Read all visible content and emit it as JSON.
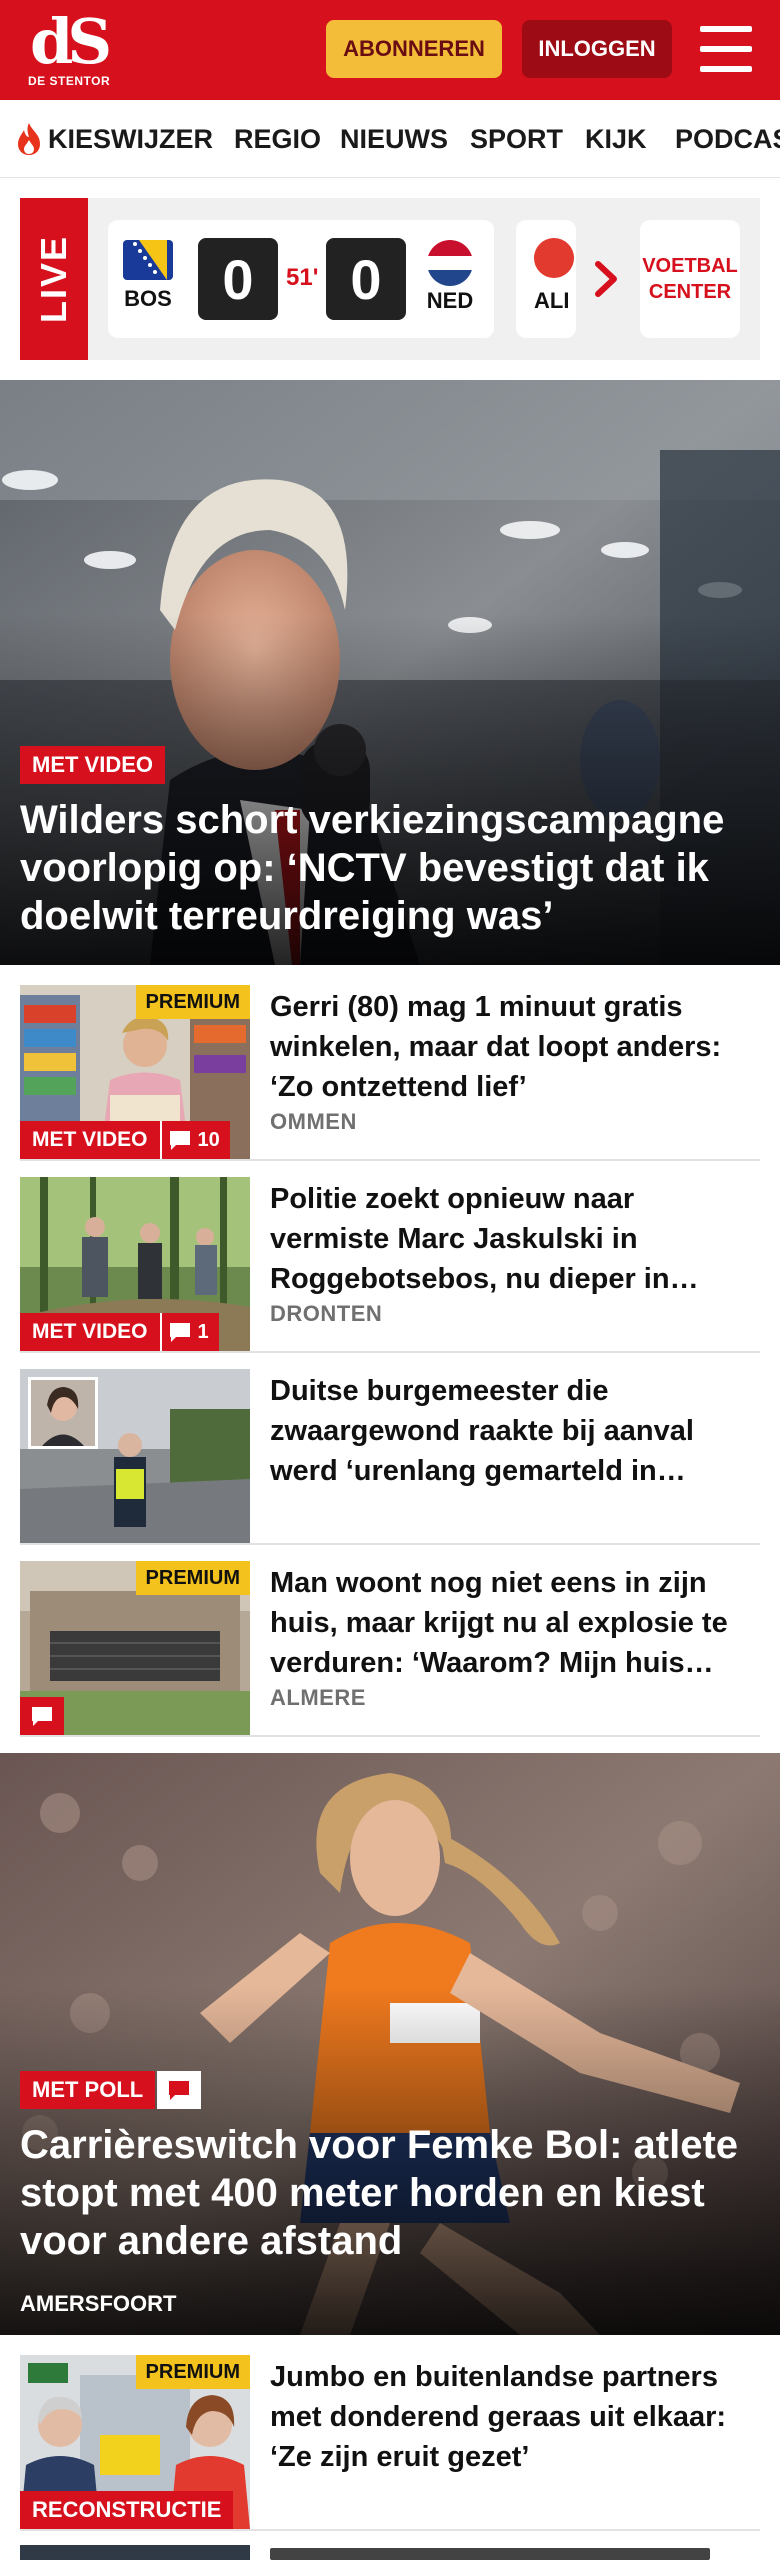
{
  "header": {
    "logo_mark": "dS",
    "logo_sub": "DE STENTOR",
    "subscribe_label": "ABONNEREN",
    "login_label": "INLOGGEN"
  },
  "nav": {
    "items": [
      "KIESWIJZER",
      "REGIO",
      "NIEUWS",
      "SPORT",
      "KIJK",
      "PODCAS"
    ]
  },
  "live": {
    "label": "LIVE",
    "match": {
      "home": "BOS",
      "away": "NED",
      "home_score": "0",
      "away_score": "0",
      "minute": "51'"
    },
    "next_match_team": "ALI",
    "voetbal_center": "VOETBAL CENTER"
  },
  "hero": {
    "badge": "MET VIDEO",
    "title": "Wilders schort verkiezingscampagne voorlopig op: ‘NCTV bevestigt dat ik doelwit terreurdreiging was’"
  },
  "articles": [
    {
      "title": "Gerri (80) mag 1 minuut gratis winkelen, maar dat loopt anders: ‘Zo ontzettend lief’",
      "location": "OMMEN",
      "premium": "PREMIUM",
      "badge": "MET VIDEO",
      "comments": "10"
    },
    {
      "title": "Politie zoekt opnieuw naar vermiste Marc Jaskulski in Roggebotsebos, nu dieper in…",
      "location": "DRONTEN",
      "badge": "MET VIDEO",
      "comments": "1"
    },
    {
      "title": "Duitse burgemeester die zwaargewond raakte bij aanval werd ‘urenlang gemarteld in…"
    },
    {
      "title": "Man woont nog niet eens in zijn huis, maar krijgt nu al explosie te verduren: ‘Waarom? Mijn huis…",
      "location": "ALMERE",
      "premium": "PREMIUM"
    }
  ],
  "hero2": {
    "badge": "MET POLL",
    "title": "Carrièreswitch voor Femke Bol: atlete stopt met 400 meter horden en kiest voor andere afstand",
    "location": "AMERSFOORT"
  },
  "article5": {
    "title": "Jumbo en buitenlandse partners met donderend geraas uit elkaar: ‘Ze zijn eruit gezet’",
    "premium": "PREMIUM",
    "badge": "RECONSTRUCTIE"
  },
  "colors": {
    "brand_red": "#d6101c",
    "premium_yellow": "#f3c21c",
    "subscribe_yellow": "#f3bd3a"
  }
}
